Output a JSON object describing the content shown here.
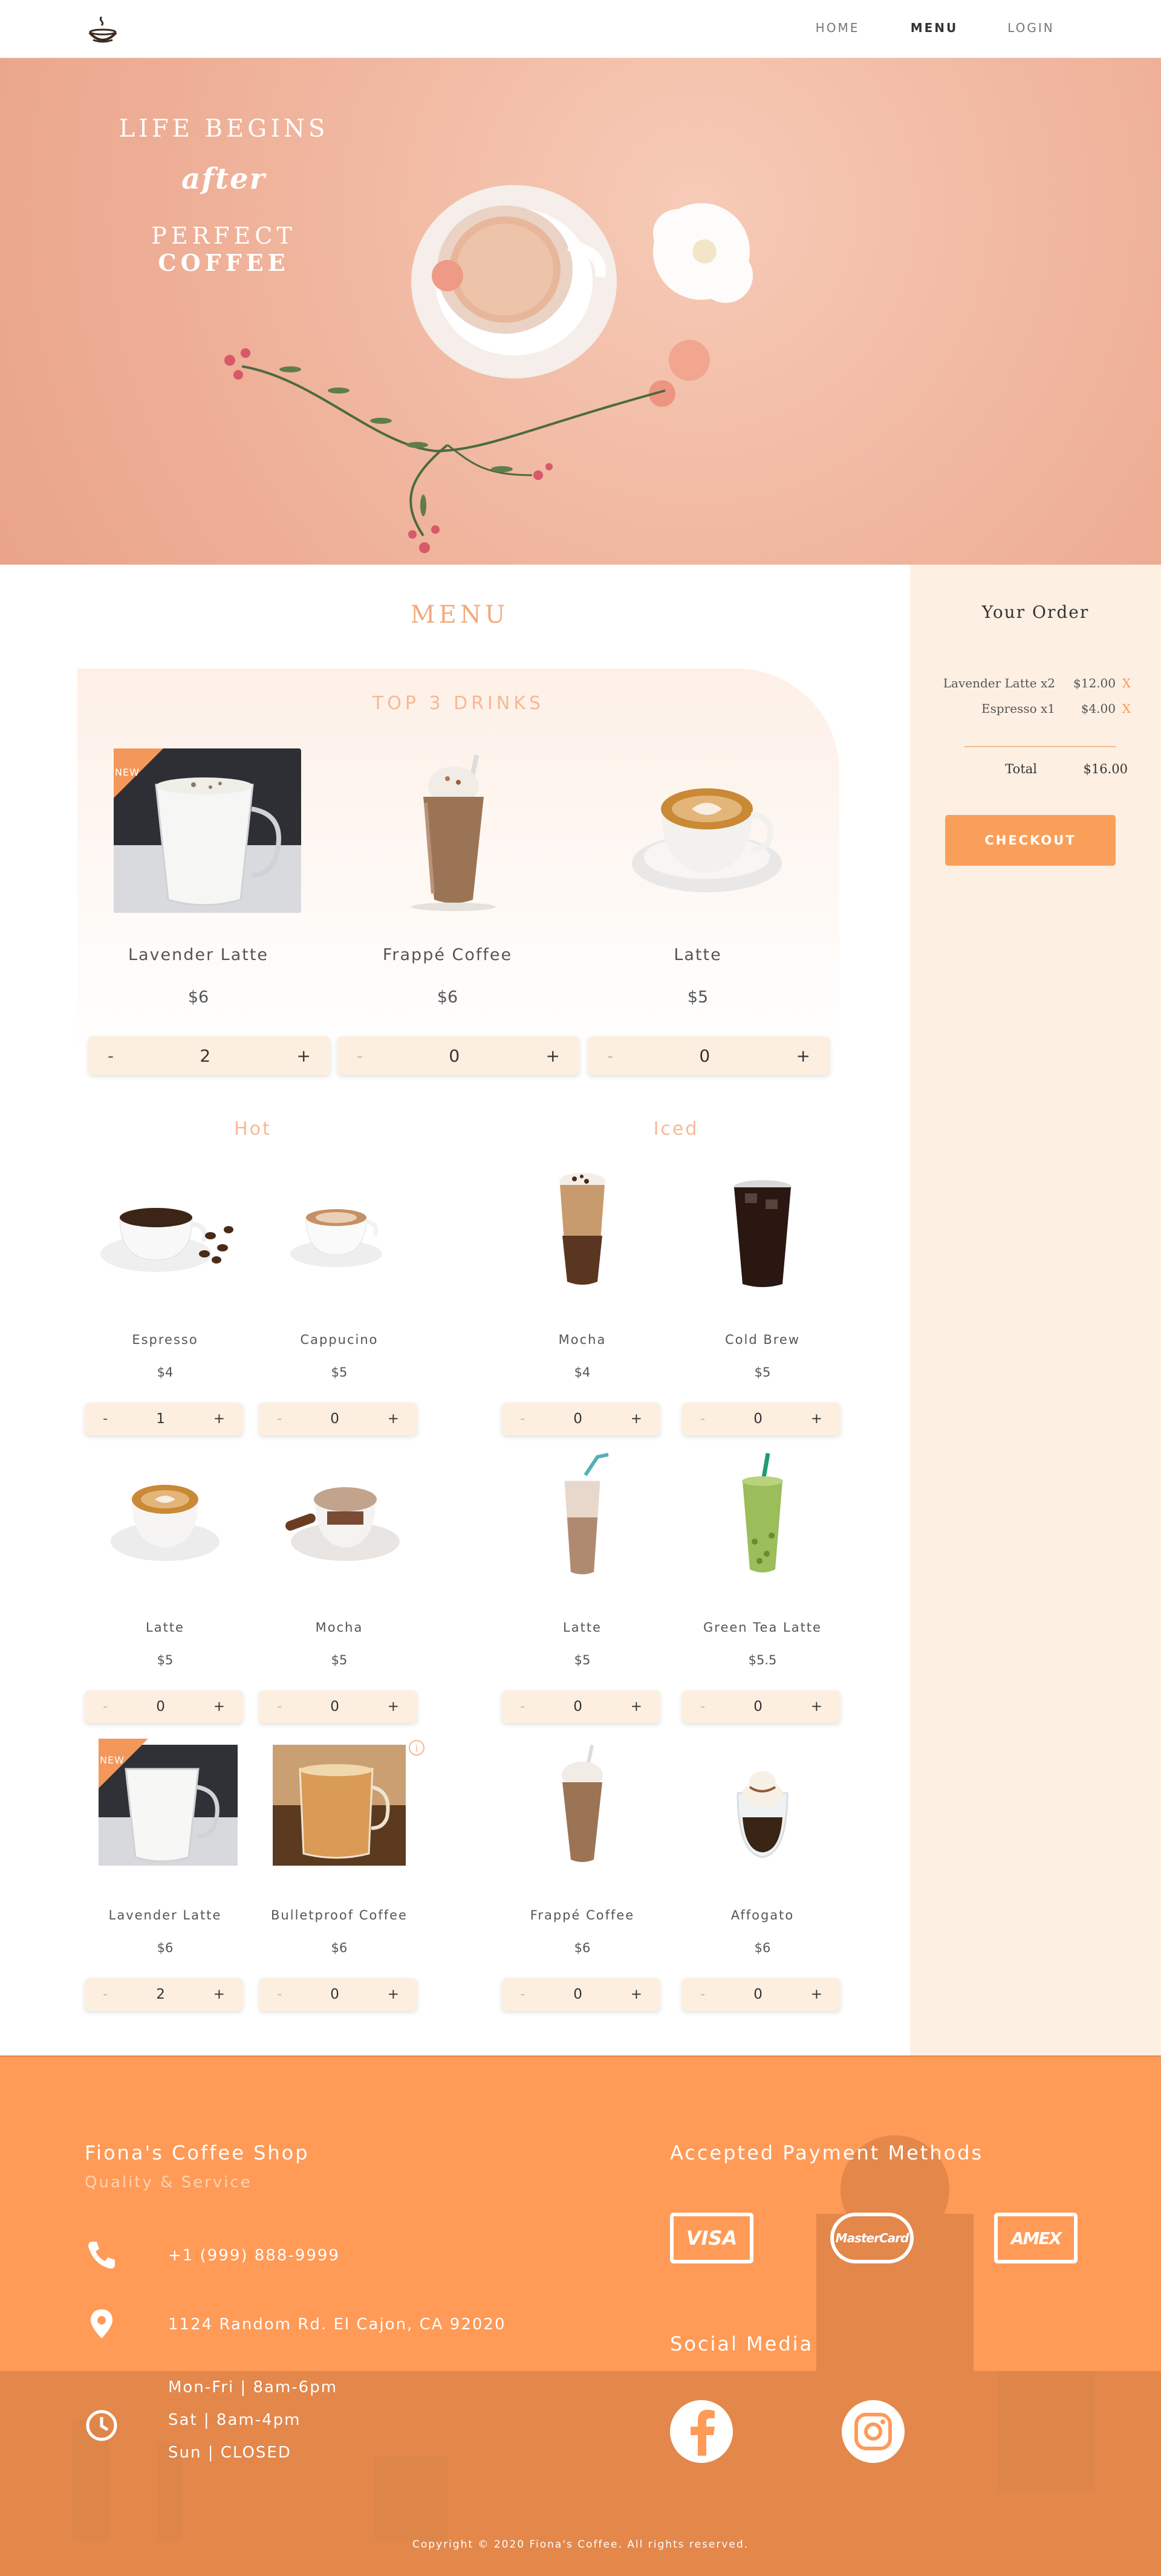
{
  "nav": {
    "links": [
      "HOME",
      "MENU",
      "LOGIN"
    ]
  },
  "hero": {
    "line1": "LIFE BEGINS",
    "line2": "after",
    "line3_a": "PERFECT ",
    "line3_b": "COFFEE"
  },
  "menu": {
    "title": "MENU",
    "top3_title": "TOP 3 DRINKS",
    "new_label": "NEW",
    "top3": [
      {
        "name": "Lavender Latte",
        "price": "$6",
        "qty": "2"
      },
      {
        "name": "Frappé Coffee",
        "price": "$6",
        "qty": "0"
      },
      {
        "name": "Latte",
        "price": "$5",
        "qty": "0"
      }
    ],
    "hot_title": "Hot",
    "iced_title": "Iced",
    "hot": [
      {
        "name": "Espresso",
        "price": "$4",
        "qty": "1"
      },
      {
        "name": "Cappucino",
        "price": "$5",
        "qty": "0"
      },
      {
        "name": "Latte",
        "price": "$5",
        "qty": "0"
      },
      {
        "name": "Mocha",
        "price": "$5",
        "qty": "0"
      },
      {
        "name": "Lavender Latte",
        "price": "$6",
        "qty": "2"
      },
      {
        "name": "Bulletproof Coffee",
        "price": "$6",
        "qty": "0"
      }
    ],
    "iced": [
      {
        "name": "Mocha",
        "price": "$4",
        "qty": "0"
      },
      {
        "name": "Cold Brew",
        "price": "$5",
        "qty": "0"
      },
      {
        "name": "Latte",
        "price": "$5",
        "qty": "0"
      },
      {
        "name": "Green Tea Latte",
        "price": "$5.5",
        "qty": "0"
      },
      {
        "name": "Frappé Coffee",
        "price": "$6",
        "qty": "0"
      },
      {
        "name": "Affogato",
        "price": "$6",
        "qty": "0"
      }
    ],
    "minus": "-",
    "plus": "+",
    "info_glyph": "i"
  },
  "order": {
    "title": "Your Order",
    "lines": [
      {
        "name": "Lavender Latte x2",
        "price": "$12.00",
        "remove": "X"
      },
      {
        "name": "Espresso x1",
        "price": "$4.00",
        "remove": "X"
      }
    ],
    "total_label": "Total",
    "total_value": "$16.00",
    "checkout_label": "CHECKOUT"
  },
  "footer": {
    "shop_name": "Fiona's Coffee Shop",
    "tagline": "Quality & Service",
    "phone": "+1 (999) 888-9999",
    "address": "1124 Random Rd. El Cajon, CA 92020",
    "hours": [
      "Mon-Fri | 8am-6pm",
      "Sat | 8am-4pm",
      "Sun | CLOSED"
    ],
    "payment_title": "Accepted Payment Methods",
    "payments": [
      "VISA",
      "MasterCard",
      "AMEX"
    ],
    "social_title": "Social Media",
    "copyright": "Copyright © 2020 Fiona's Coffee. All rights reserved."
  },
  "colors": {
    "accent": "#fa9f59",
    "hero_bg": "#efb199",
    "sidebar_bg": "#fdf0e3",
    "qty_bg": "#fdefe0",
    "footer_bg": "#ff9a57"
  },
  "icons": [
    "coffee-cup-logo-icon",
    "phone-icon",
    "location-pin-icon",
    "clock-icon",
    "facebook-icon",
    "instagram-icon",
    "info-icon"
  ]
}
